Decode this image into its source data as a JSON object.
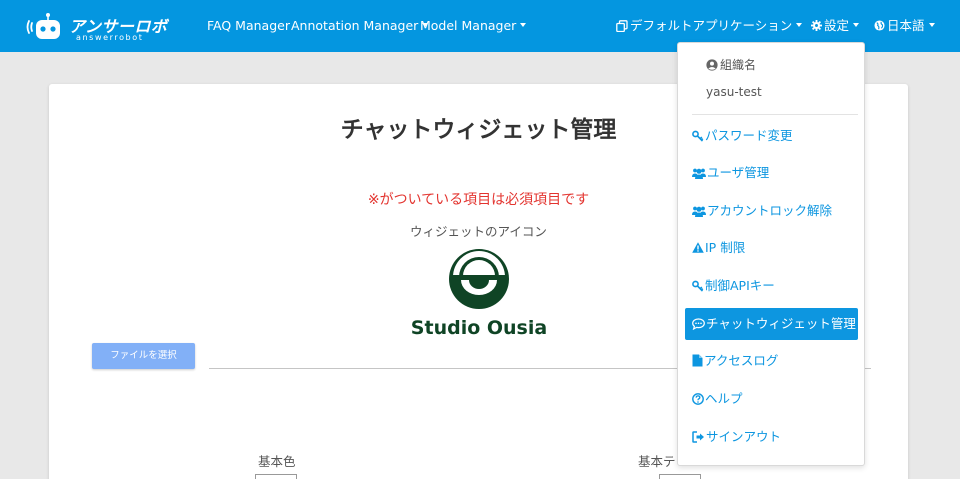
{
  "navbar": {
    "logo": {
      "title": "アンサーロボ",
      "subtitle": "answerrobot"
    },
    "links": {
      "faq": "FAQ Manager",
      "annotation": "Annotation Manager",
      "model": "Model Manager"
    },
    "app_selector": "デフォルトアプリケーション",
    "settings": "設定",
    "language": "日本語"
  },
  "dropdown": {
    "org_label": "組織名",
    "user": "yasu-test",
    "items": [
      {
        "label": "パスワード変更",
        "icon": "key-icon"
      },
      {
        "label": "ユーザ管理",
        "icon": "users-icon"
      },
      {
        "label": "アカウントロック解除",
        "icon": "users-icon"
      },
      {
        "label": "IP 制限",
        "icon": "warning-icon"
      },
      {
        "label": "制御APIキー",
        "icon": "key-icon"
      },
      {
        "label": "チャットウィジェット管理",
        "icon": "comment-icon",
        "active": true
      },
      {
        "label": "アクセスログ",
        "icon": "file-icon"
      },
      {
        "label": "ヘルプ",
        "icon": "question-icon"
      },
      {
        "label": "サインアウト",
        "icon": "sign-out-icon"
      }
    ]
  },
  "main": {
    "title": "チャットウィジェット管理",
    "required_note": "※がついている項目は必須項目です",
    "icon_label": "ウィジェットのアイコン",
    "icon_image_text": "Studio Ousia",
    "file_button": "ファイルを選択",
    "base_color_label": "基本色",
    "base_text_label": "基本テ"
  },
  "colors": {
    "navbar": "#0496e0",
    "link": "#0d96e0",
    "required": "#e3342f",
    "file_button": "#82b0f7",
    "logo_green": "#0f4425"
  }
}
